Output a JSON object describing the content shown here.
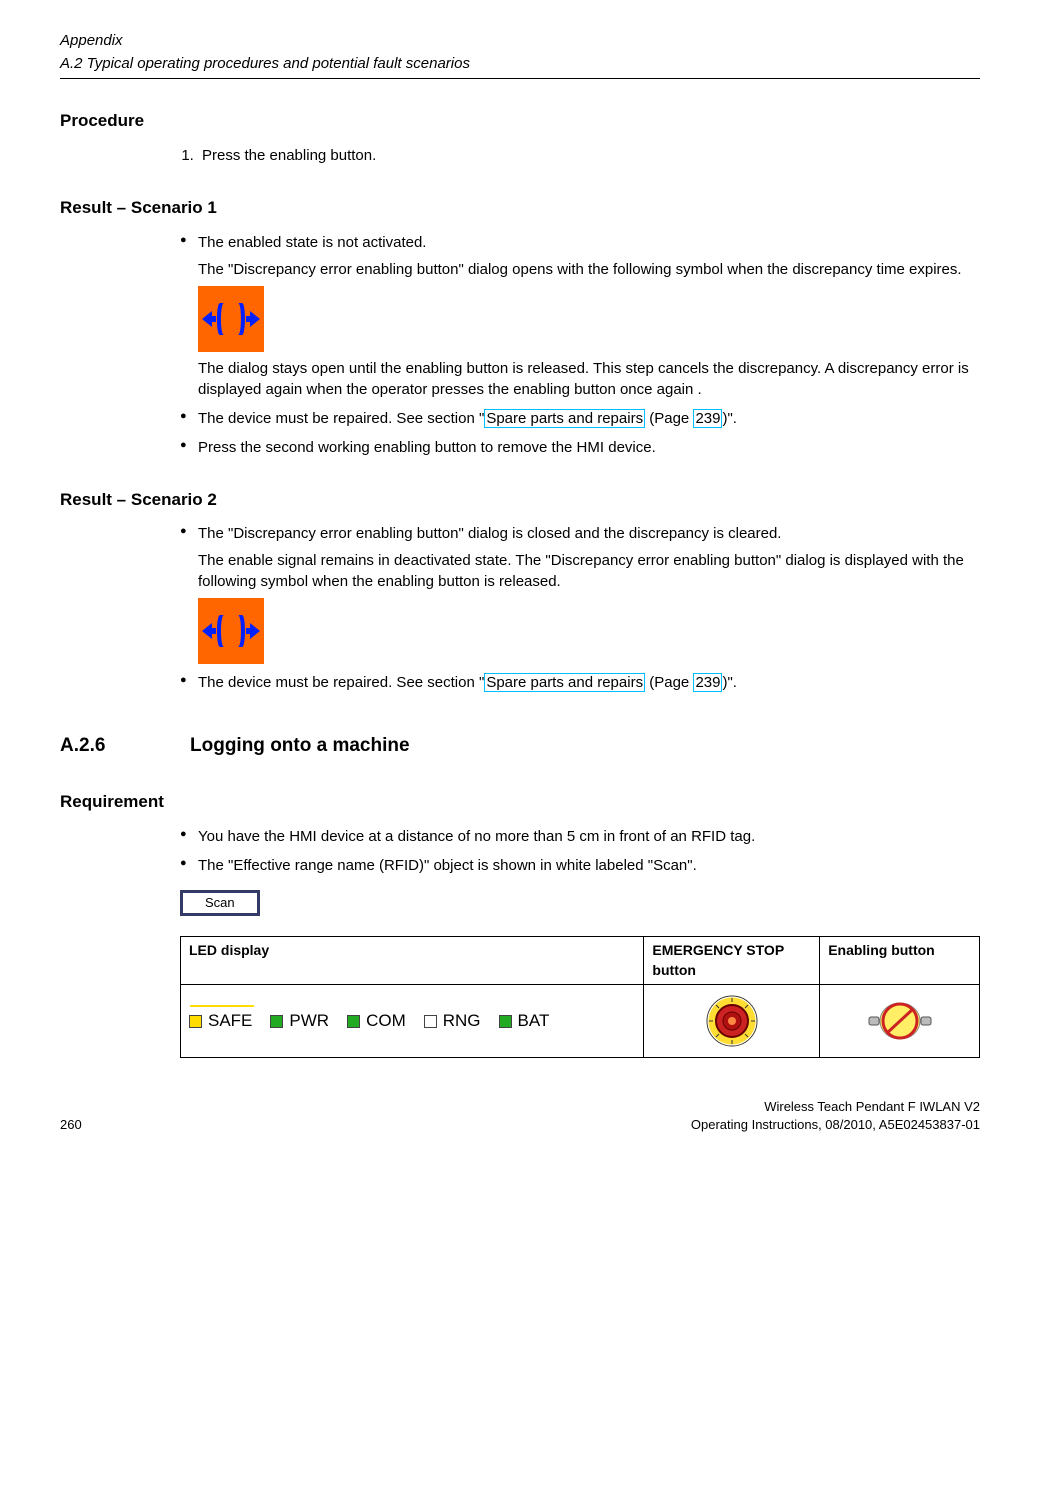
{
  "header": {
    "chapter": "Appendix",
    "section": "A.2 Typical operating procedures and potential fault scenarios"
  },
  "procedure": {
    "heading": "Procedure",
    "step1": "Press the enabling button."
  },
  "scenario1": {
    "heading": "Result – Scenario 1",
    "bullet1": "The enabled state is not activated.",
    "para1": "The \"Discrepancy error enabling button\" dialog opens with the following symbol when the discrepancy time expires.",
    "para2": "The dialog stays open until the enabling button is released. This step cancels the discrepancy. A discrepancy error is displayed again when the operator presses the enabling button once again .",
    "bullet2_pre": "The device must be repaired. See section \"",
    "bullet2_link": "Spare parts and repairs",
    "bullet2_mid": " (Page ",
    "bullet2_page": "239",
    "bullet2_post": ")\".",
    "bullet3": "Press the second working enabling button to remove the HMI device."
  },
  "scenario2": {
    "heading": "Result – Scenario 2",
    "bullet1": "The \"Discrepancy error enabling button\" dialog is closed and the discrepancy is cleared.",
    "para1": "The enable signal remains in deactivated state. The \"Discrepancy error enabling button\" dialog is displayed with the following symbol when the enabling button is released.",
    "bullet2_pre": "The device must be repaired. See section \"",
    "bullet2_link": "Spare parts and repairs",
    "bullet2_mid": " (Page ",
    "bullet2_page": "239",
    "bullet2_post": ")\"."
  },
  "subsection": {
    "num": "A.2.6",
    "title": "Logging onto a machine"
  },
  "requirement": {
    "heading": "Requirement",
    "bullet1": "You have the HMI device at a distance of no more than 5 cm in front of an RFID tag.",
    "bullet2": "The \"Effective range name (RFID)\" object is shown in white labeled \"Scan\".",
    "scan_label": "Scan"
  },
  "table": {
    "col1": "LED display",
    "col2": "EMERGENCY STOP button",
    "col3": "Enabling button",
    "leds": {
      "safe": "SAFE",
      "pwr": "PWR",
      "com": "COM",
      "rng": "RNG",
      "bat": "BAT"
    }
  },
  "footer": {
    "page": "260",
    "doc_title": "Wireless Teach Pendant F IWLAN V2",
    "doc_info": "Operating Instructions, 08/2010, A5E02453837-01"
  }
}
